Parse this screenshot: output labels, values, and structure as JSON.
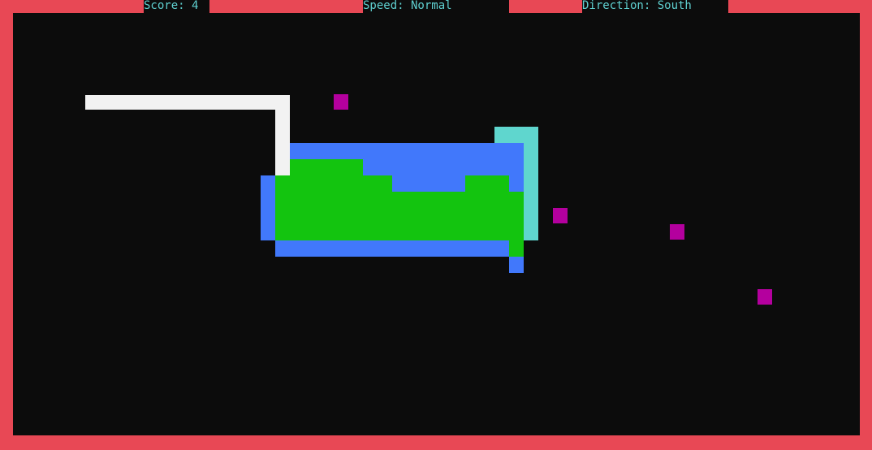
{
  "colors": {
    "border": "#e84855",
    "arena": "#0c0c0c",
    "hud_text": "#5fd0d0",
    "hud_bg": "#0c0c0c",
    "snake_white": "#f2f2f2",
    "snake_blue": "#4178fb",
    "snake_green": "#13c40f",
    "snake_cyan": "#5fd6ce",
    "food": "#b4009e"
  },
  "hud": {
    "score": "Score: 4",
    "speed": "Speed: Normal",
    "direction": "Direction: South"
  }
}
